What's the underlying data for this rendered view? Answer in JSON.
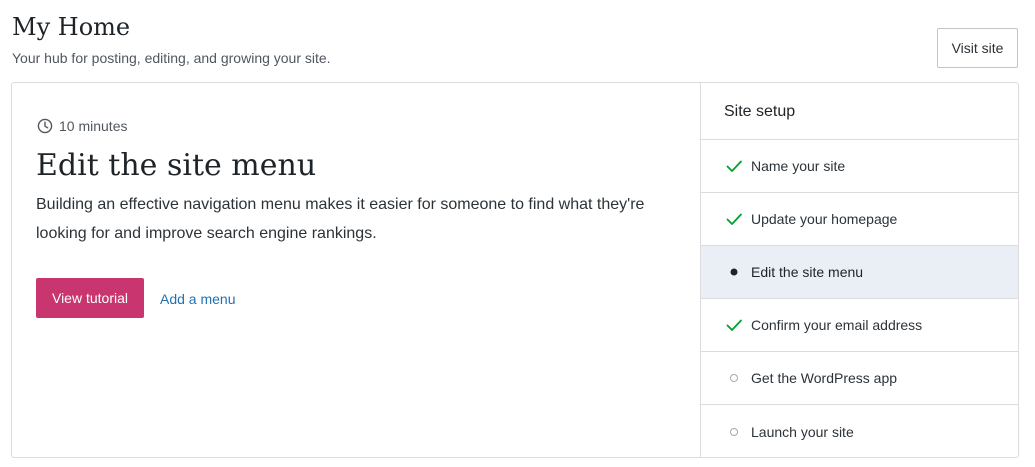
{
  "header": {
    "title": "My Home",
    "subtitle": "Your hub for posting, editing, and growing your site.",
    "visit_site_label": "Visit site"
  },
  "task": {
    "duration": "10 minutes",
    "duration_icon": "clock-icon",
    "title": "Edit the site menu",
    "description": "Building an effective navigation menu makes it easier for someone to find what they're looking for and improve search engine rankings.",
    "primary_button": "View tutorial",
    "secondary_link": "Add a menu"
  },
  "site_setup": {
    "heading": "Site setup",
    "items": [
      {
        "label": "Name your site",
        "status": "complete",
        "icon": "checkmark-icon"
      },
      {
        "label": "Update your homepage",
        "status": "complete",
        "icon": "checkmark-icon"
      },
      {
        "label": "Edit the site menu",
        "status": "current",
        "icon": "filled-dot-icon"
      },
      {
        "label": "Confirm your email address",
        "status": "complete",
        "icon": "checkmark-icon"
      },
      {
        "label": "Get the WordPress app",
        "status": "incomplete",
        "icon": "empty-circle-icon"
      },
      {
        "label": "Launch your site",
        "status": "incomplete",
        "icon": "empty-circle-icon"
      }
    ]
  },
  "colors": {
    "accent_pink": "#c9356e",
    "link_blue": "#2271b1",
    "check_green": "#00a32a",
    "active_row_bg": "#e9eff5",
    "border": "#dcdcde"
  }
}
